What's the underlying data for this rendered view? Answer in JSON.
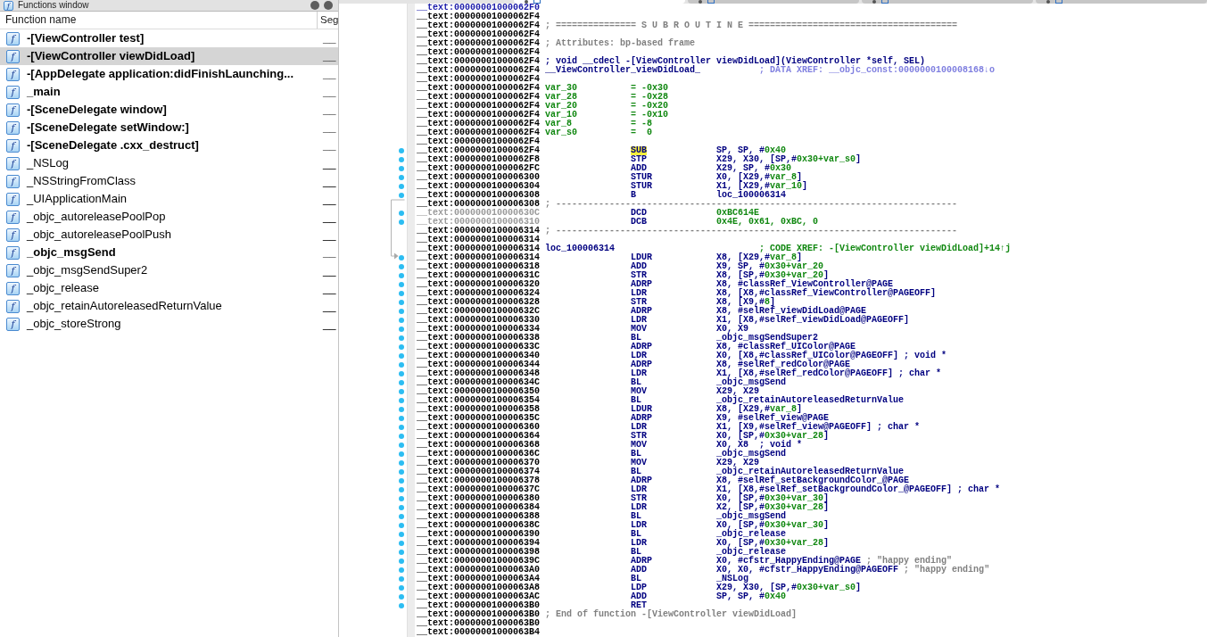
{
  "functions_window": {
    "title_icon": "f",
    "title": "Functions window",
    "columns": [
      "Function name",
      "Seg"
    ],
    "rows": [
      {
        "icon": "f",
        "name": "-[ViewController test]",
        "segment": "__",
        "bold": true,
        "selected": false
      },
      {
        "icon": "f",
        "name": "-[ViewController viewDidLoad]",
        "segment": "__",
        "bold": true,
        "selected": true
      },
      {
        "icon": "f",
        "name": "-[AppDelegate application:didFinishLaunching...",
        "segment": "__",
        "bold": true,
        "selected": false
      },
      {
        "icon": "f",
        "name": "_main",
        "segment": "__",
        "bold": true,
        "selected": false
      },
      {
        "icon": "f",
        "name": "-[SceneDelegate window]",
        "segment": "__",
        "bold": true,
        "selected": false
      },
      {
        "icon": "f",
        "name": "-[SceneDelegate setWindow:]",
        "segment": "__",
        "bold": true,
        "selected": false
      },
      {
        "icon": "f",
        "name": "-[SceneDelegate .cxx_destruct]",
        "segment": "__",
        "bold": true,
        "selected": false
      },
      {
        "icon": "f",
        "name": "_NSLog",
        "segment": "__",
        "bold": false,
        "selected": false
      },
      {
        "icon": "f",
        "name": "_NSStringFromClass",
        "segment": "__",
        "bold": false,
        "selected": false
      },
      {
        "icon": "f",
        "name": "_UIApplicationMain",
        "segment": "__",
        "bold": false,
        "selected": false
      },
      {
        "icon": "f",
        "name": "_objc_autoreleasePoolPop",
        "segment": "__",
        "bold": false,
        "selected": false
      },
      {
        "icon": "f",
        "name": "_objc_autoreleasePoolPush",
        "segment": "__",
        "bold": false,
        "selected": false
      },
      {
        "icon": "f",
        "name": "_objc_msgSend",
        "segment": "__",
        "bold": true,
        "selected": false
      },
      {
        "icon": "f",
        "name": "_objc_msgSendSuper2",
        "segment": "__",
        "bold": false,
        "selected": false
      },
      {
        "icon": "f",
        "name": "_objc_release",
        "segment": "__",
        "bold": false,
        "selected": false
      },
      {
        "icon": "f",
        "name": "_objc_retainAutoreleasedReturnValue",
        "segment": "__",
        "bold": false,
        "selected": false
      },
      {
        "icon": "f",
        "name": "_objc_storeStrong",
        "segment": "__",
        "bold": false,
        "selected": false
      }
    ]
  },
  "view_tabs": [
    {
      "selected": true
    },
    {
      "selected": false
    },
    {
      "selected": false
    },
    {
      "selected": false
    }
  ],
  "disassembly": {
    "lines": [
      {
        "kind": "head",
        "address": "__text:00000001000062F0"
      },
      {
        "kind": "blank",
        "address": "__text:00000001000062F4"
      },
      {
        "kind": "comment",
        "address": "__text:00000001000062F4",
        "text": "; =============== S U B R O U T I N E ======================================="
      },
      {
        "kind": "blank",
        "address": "__text:00000001000062F4"
      },
      {
        "kind": "comment",
        "address": "__text:00000001000062F4",
        "text": "; Attributes: bp-based frame"
      },
      {
        "kind": "blank",
        "address": "__text:00000001000062F4"
      },
      {
        "kind": "prototype",
        "address": "__text:00000001000062F4",
        "text": "; void __cdecl -[ViewController viewDidLoad](ViewController *self, SEL)"
      },
      {
        "kind": "label",
        "address": "__text:00000001000062F4",
        "label": "__ViewController_viewDidLoad_",
        "xref": {
          "text": "; DATA XREF: __objc_const:0000000100008168↓o",
          "kind": "data"
        }
      },
      {
        "kind": "blank",
        "address": "__text:00000001000062F4"
      },
      {
        "kind": "var",
        "address": "__text:00000001000062F4",
        "name": "var_30",
        "value": "= -0x30"
      },
      {
        "kind": "var",
        "address": "__text:00000001000062F4",
        "name": "var_28",
        "value": "= -0x28"
      },
      {
        "kind": "var",
        "address": "__text:00000001000062F4",
        "name": "var_20",
        "value": "= -0x20"
      },
      {
        "kind": "var",
        "address": "__text:00000001000062F4",
        "name": "var_10",
        "value": "= -0x10"
      },
      {
        "kind": "var",
        "address": "__text:00000001000062F4",
        "name": "var_8",
        "value": "= -8"
      },
      {
        "kind": "var",
        "address": "__text:00000001000062F4",
        "name": "var_s0",
        "value": "=  0"
      },
      {
        "kind": "blank",
        "address": "__text:00000001000062F4"
      },
      {
        "kind": "insn",
        "address": "__text:00000001000062F4",
        "mnemonic": "SUB",
        "operands": [
          {
            "text": "SP, SP, #",
            "kind": "op"
          },
          {
            "text": "0x40",
            "kind": "num"
          }
        ],
        "highlighted": true
      },
      {
        "kind": "insn",
        "address": "__text:00000001000062F8",
        "mnemonic": "STP",
        "operands": [
          {
            "text": "X29, X30, [SP,#",
            "kind": "op"
          },
          {
            "text": "0x30+var_s0",
            "kind": "num"
          },
          {
            "text": "]",
            "kind": "op"
          }
        ],
        "highlighted": false
      },
      {
        "kind": "insn",
        "address": "__text:00000001000062FC",
        "mnemonic": "ADD",
        "operands": [
          {
            "text": "X29, SP, #",
            "kind": "op"
          },
          {
            "text": "0x30",
            "kind": "num"
          }
        ],
        "highlighted": false
      },
      {
        "kind": "insn",
        "address": "__text:0000000100006300",
        "mnemonic": "STUR",
        "operands": [
          {
            "text": "X0, [X29,#",
            "kind": "op"
          },
          {
            "text": "var_8",
            "kind": "num"
          },
          {
            "text": "]",
            "kind": "op"
          }
        ],
        "highlighted": false
      },
      {
        "kind": "insn",
        "address": "__text:0000000100006304",
        "mnemonic": "STUR",
        "operands": [
          {
            "text": "X1, [X29,#",
            "kind": "op"
          },
          {
            "text": "var_10",
            "kind": "num"
          },
          {
            "text": "]",
            "kind": "op"
          }
        ],
        "highlighted": false
      },
      {
        "kind": "insn",
        "address": "__text:0000000100006308",
        "mnemonic": "B",
        "operands": [
          {
            "text": "loc_100006314",
            "kind": "op"
          }
        ],
        "highlighted": false,
        "jump": {
          "kind": "source"
        }
      },
      {
        "kind": "comment",
        "address": "__text:0000000100006308",
        "text": "; ---------------------------------------------------------------------------"
      },
      {
        "kind": "data",
        "address": "__text:000000010000630C",
        "mnemonic": "DCD",
        "operands": [
          {
            "text": "0xBC614E",
            "kind": "num"
          }
        ],
        "highlighted": false
      },
      {
        "kind": "data",
        "address": "__text:0000000100006310",
        "mnemonic": "DCB",
        "operands": [
          {
            "text": "0x4E, 0x61, 0xBC, 0",
            "kind": "num"
          }
        ],
        "highlighted": false
      },
      {
        "kind": "comment",
        "address": "__text:0000000100006314",
        "text": "; ---------------------------------------------------------------------------"
      },
      {
        "kind": "blank",
        "address": "__text:0000000100006314"
      },
      {
        "kind": "label",
        "address": "__text:0000000100006314",
        "label": "loc_100006314",
        "xref": {
          "text": "; CODE XREF: -[ViewController viewDidLoad]+14↑j",
          "kind": "code"
        }
      },
      {
        "kind": "insn",
        "address": "__text:0000000100006314",
        "mnemonic": "LDUR",
        "operands": [
          {
            "text": "X8, [X29,#",
            "kind": "op"
          },
          {
            "text": "var_8",
            "kind": "num"
          },
          {
            "text": "]",
            "kind": "op"
          }
        ],
        "highlighted": false,
        "jump": {
          "kind": "target"
        }
      },
      {
        "kind": "insn",
        "address": "__text:0000000100006318",
        "mnemonic": "ADD",
        "operands": [
          {
            "text": "X9, SP, #",
            "kind": "op"
          },
          {
            "text": "0x30+var_20",
            "kind": "num"
          }
        ],
        "highlighted": false
      },
      {
        "kind": "insn",
        "address": "__text:000000010000631C",
        "mnemonic": "STR",
        "operands": [
          {
            "text": "X8, [SP,#",
            "kind": "op"
          },
          {
            "text": "0x30+var_20",
            "kind": "num"
          },
          {
            "text": "]",
            "kind": "op"
          }
        ],
        "highlighted": false
      },
      {
        "kind": "insn",
        "address": "__text:0000000100006320",
        "mnemonic": "ADRP",
        "operands": [
          {
            "text": "X8, #classRef_ViewController@PAGE",
            "kind": "op"
          }
        ],
        "highlighted": false
      },
      {
        "kind": "insn",
        "address": "__text:0000000100006324",
        "mnemonic": "LDR",
        "operands": [
          {
            "text": "X8, [X8,#classRef_ViewController@PAGEOFF]",
            "kind": "op"
          }
        ],
        "highlighted": false
      },
      {
        "kind": "insn",
        "address": "__text:0000000100006328",
        "mnemonic": "STR",
        "operands": [
          {
            "text": "X8, [X9,#",
            "kind": "op"
          },
          {
            "text": "8",
            "kind": "num"
          },
          {
            "text": "]",
            "kind": "op"
          }
        ],
        "highlighted": false
      },
      {
        "kind": "insn",
        "address": "__text:000000010000632C",
        "mnemonic": "ADRP",
        "operands": [
          {
            "text": "X8, #selRef_viewDidLoad@PAGE",
            "kind": "op"
          }
        ],
        "highlighted": false
      },
      {
        "kind": "insn",
        "address": "__text:0000000100006330",
        "mnemonic": "LDR",
        "operands": [
          {
            "text": "X1, [X8,#selRef_viewDidLoad@PAGEOFF]",
            "kind": "op"
          }
        ],
        "highlighted": false
      },
      {
        "kind": "insn",
        "address": "__text:0000000100006334",
        "mnemonic": "MOV",
        "operands": [
          {
            "text": "X0, X9",
            "kind": "op"
          }
        ],
        "highlighted": false
      },
      {
        "kind": "insn",
        "address": "__text:0000000100006338",
        "mnemonic": "BL",
        "operands": [
          {
            "text": "_objc_msgSendSuper2",
            "kind": "op"
          }
        ],
        "highlighted": false
      },
      {
        "kind": "insn",
        "address": "__text:000000010000633C",
        "mnemonic": "ADRP",
        "operands": [
          {
            "text": "X8, #classRef_UIColor@PAGE",
            "kind": "op"
          }
        ],
        "highlighted": false
      },
      {
        "kind": "insn",
        "address": "__text:0000000100006340",
        "mnemonic": "LDR",
        "operands": [
          {
            "text": "X0, [X8,#classRef_UIColor@PAGEOFF] ; void *",
            "kind": "op"
          }
        ],
        "highlighted": false
      },
      {
        "kind": "insn",
        "address": "__text:0000000100006344",
        "mnemonic": "ADRP",
        "operands": [
          {
            "text": "X8, #selRef_redColor@PAGE",
            "kind": "op"
          }
        ],
        "highlighted": false
      },
      {
        "kind": "insn",
        "address": "__text:0000000100006348",
        "mnemonic": "LDR",
        "operands": [
          {
            "text": "X1, [X8,#selRef_redColor@PAGEOFF] ; char *",
            "kind": "op"
          }
        ],
        "highlighted": false
      },
      {
        "kind": "insn",
        "address": "__text:000000010000634C",
        "mnemonic": "BL",
        "operands": [
          {
            "text": "_objc_msgSend",
            "kind": "op"
          }
        ],
        "highlighted": false
      },
      {
        "kind": "insn",
        "address": "__text:0000000100006350",
        "mnemonic": "MOV",
        "operands": [
          {
            "text": "X29, X29",
            "kind": "op"
          }
        ],
        "highlighted": false
      },
      {
        "kind": "insn",
        "address": "__text:0000000100006354",
        "mnemonic": "BL",
        "operands": [
          {
            "text": "_objc_retainAutoreleasedReturnValue",
            "kind": "op"
          }
        ],
        "highlighted": false
      },
      {
        "kind": "insn",
        "address": "__text:0000000100006358",
        "mnemonic": "LDUR",
        "operands": [
          {
            "text": "X8, [X29,#",
            "kind": "op"
          },
          {
            "text": "var_8",
            "kind": "num"
          },
          {
            "text": "]",
            "kind": "op"
          }
        ],
        "highlighted": false
      },
      {
        "kind": "insn",
        "address": "__text:000000010000635C",
        "mnemonic": "ADRP",
        "operands": [
          {
            "text": "X9, #selRef_view@PAGE",
            "kind": "op"
          }
        ],
        "highlighted": false
      },
      {
        "kind": "insn",
        "address": "__text:0000000100006360",
        "mnemonic": "LDR",
        "operands": [
          {
            "text": "X1, [X9,#selRef_view@PAGEOFF] ; char *",
            "kind": "op"
          }
        ],
        "highlighted": false
      },
      {
        "kind": "insn",
        "address": "__text:0000000100006364",
        "mnemonic": "STR",
        "operands": [
          {
            "text": "X0, [SP,#",
            "kind": "op"
          },
          {
            "text": "0x30+var_28",
            "kind": "num"
          },
          {
            "text": "]",
            "kind": "op"
          }
        ],
        "highlighted": false
      },
      {
        "kind": "insn",
        "address": "__text:0000000100006368",
        "mnemonic": "MOV",
        "operands": [
          {
            "text": "X0, X8  ; void *",
            "kind": "op"
          }
        ],
        "highlighted": false
      },
      {
        "kind": "insn",
        "address": "__text:000000010000636C",
        "mnemonic": "BL",
        "operands": [
          {
            "text": "_objc_msgSend",
            "kind": "op"
          }
        ],
        "highlighted": false
      },
      {
        "kind": "insn",
        "address": "__text:0000000100006370",
        "mnemonic": "MOV",
        "operands": [
          {
            "text": "X29, X29",
            "kind": "op"
          }
        ],
        "highlighted": false
      },
      {
        "kind": "insn",
        "address": "__text:0000000100006374",
        "mnemonic": "BL",
        "operands": [
          {
            "text": "_objc_retainAutoreleasedReturnValue",
            "kind": "op"
          }
        ],
        "highlighted": false
      },
      {
        "kind": "insn",
        "address": "__text:0000000100006378",
        "mnemonic": "ADRP",
        "operands": [
          {
            "text": "X8, #selRef_setBackgroundColor_@PAGE",
            "kind": "op"
          }
        ],
        "highlighted": false
      },
      {
        "kind": "insn",
        "address": "__text:000000010000637C",
        "mnemonic": "LDR",
        "operands": [
          {
            "text": "X1, [X8,#selRef_setBackgroundColor_@PAGEOFF] ; char *",
            "kind": "op"
          }
        ],
        "highlighted": false
      },
      {
        "kind": "insn",
        "address": "__text:0000000100006380",
        "mnemonic": "STR",
        "operands": [
          {
            "text": "X0, [SP,#",
            "kind": "op"
          },
          {
            "text": "0x30+var_30",
            "kind": "num"
          },
          {
            "text": "]",
            "kind": "op"
          }
        ],
        "highlighted": false
      },
      {
        "kind": "insn",
        "address": "__text:0000000100006384",
        "mnemonic": "LDR",
        "operands": [
          {
            "text": "X2, [SP,#",
            "kind": "op"
          },
          {
            "text": "0x30+var_28",
            "kind": "num"
          },
          {
            "text": "]",
            "kind": "op"
          }
        ],
        "highlighted": false
      },
      {
        "kind": "insn",
        "address": "__text:0000000100006388",
        "mnemonic": "BL",
        "operands": [
          {
            "text": "_objc_msgSend",
            "kind": "op"
          }
        ],
        "highlighted": false
      },
      {
        "kind": "insn",
        "address": "__text:000000010000638C",
        "mnemonic": "LDR",
        "operands": [
          {
            "text": "X0, [SP,#",
            "kind": "op"
          },
          {
            "text": "0x30+var_30",
            "kind": "num"
          },
          {
            "text": "]",
            "kind": "op"
          }
        ],
        "highlighted": false
      },
      {
        "kind": "insn",
        "address": "__text:0000000100006390",
        "mnemonic": "BL",
        "operands": [
          {
            "text": "_objc_release",
            "kind": "op"
          }
        ],
        "highlighted": false
      },
      {
        "kind": "insn",
        "address": "__text:0000000100006394",
        "mnemonic": "LDR",
        "operands": [
          {
            "text": "X0, [SP,#",
            "kind": "op"
          },
          {
            "text": "0x30+var_28",
            "kind": "num"
          },
          {
            "text": "]",
            "kind": "op"
          }
        ],
        "highlighted": false
      },
      {
        "kind": "insn",
        "address": "__text:0000000100006398",
        "mnemonic": "BL",
        "operands": [
          {
            "text": "_objc_release",
            "kind": "op"
          }
        ],
        "highlighted": false
      },
      {
        "kind": "insn",
        "address": "__text:000000010000639C",
        "mnemonic": "ADRP",
        "operands": [
          {
            "text": "X0, #cfstr_HappyEnding@PAGE",
            "kind": "op"
          },
          {
            "text": " ; \"happy ending\"",
            "kind": "cmt"
          }
        ],
        "highlighted": false
      },
      {
        "kind": "insn",
        "address": "__text:00000001000063A0",
        "mnemonic": "ADD",
        "operands": [
          {
            "text": "X0, X0, #cfstr_HappyEnding@PAGEOFF",
            "kind": "op"
          },
          {
            "text": " ; \"happy ending\"",
            "kind": "cmt"
          }
        ],
        "highlighted": false
      },
      {
        "kind": "insn",
        "address": "__text:00000001000063A4",
        "mnemonic": "BL",
        "operands": [
          {
            "text": "_NSLog",
            "kind": "op"
          }
        ],
        "highlighted": false
      },
      {
        "kind": "insn",
        "address": "__text:00000001000063A8",
        "mnemonic": "LDP",
        "operands": [
          {
            "text": "X29, X30, [SP,#",
            "kind": "op"
          },
          {
            "text": "0x30+var_s0",
            "kind": "num"
          },
          {
            "text": "]",
            "kind": "op"
          }
        ],
        "highlighted": false
      },
      {
        "kind": "insn",
        "address": "__text:00000001000063AC",
        "mnemonic": "ADD",
        "operands": [
          {
            "text": "SP, SP, #",
            "kind": "op"
          },
          {
            "text": "0x40",
            "kind": "num"
          }
        ],
        "highlighted": false
      },
      {
        "kind": "insn",
        "address": "__text:00000001000063B0",
        "mnemonic": "RET",
        "highlighted": false
      },
      {
        "kind": "comment",
        "address": "__text:00000001000063B0",
        "text": "; End of function -[ViewController viewDidLoad]"
      },
      {
        "kind": "blank",
        "address": "__text:00000001000063B0"
      },
      {
        "kind": "blank",
        "address": "__text:00000001000063B4"
      }
    ]
  }
}
